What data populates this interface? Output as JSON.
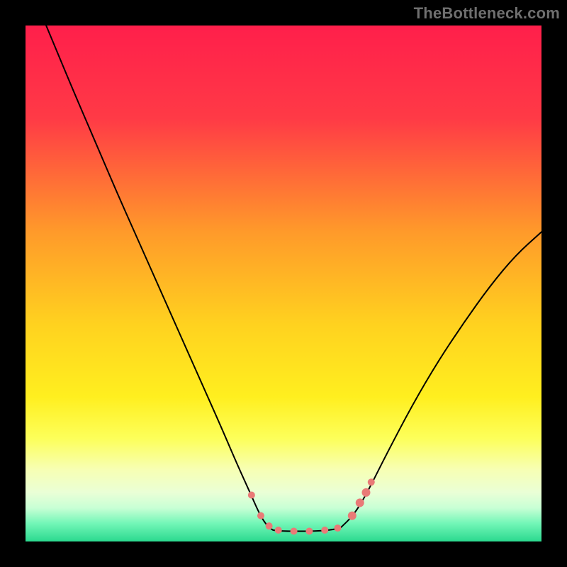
{
  "watermark": "TheBottleneck.com",
  "chart_data": {
    "type": "line",
    "title": "",
    "xlabel": "",
    "ylabel": "",
    "xlim": [
      0,
      100
    ],
    "ylim": [
      0,
      100
    ],
    "gradient_stops": [
      {
        "offset": 0.0,
        "color": "#ff1f4b"
      },
      {
        "offset": 0.18,
        "color": "#ff3a46"
      },
      {
        "offset": 0.4,
        "color": "#ff9a2a"
      },
      {
        "offset": 0.58,
        "color": "#ffd21f"
      },
      {
        "offset": 0.72,
        "color": "#ffef1f"
      },
      {
        "offset": 0.8,
        "color": "#fdff5a"
      },
      {
        "offset": 0.86,
        "color": "#f7ffb3"
      },
      {
        "offset": 0.905,
        "color": "#eaffd6"
      },
      {
        "offset": 0.935,
        "color": "#c8ffd5"
      },
      {
        "offset": 0.965,
        "color": "#72f6b7"
      },
      {
        "offset": 1.0,
        "color": "#2bd98f"
      }
    ],
    "series": [
      {
        "name": "left-branch",
        "x": [
          4.0,
          6.5,
          9.0,
          12.0,
          15.0,
          18.0,
          22.0,
          26.0,
          30.0,
          34.0,
          38.0,
          41.0,
          43.5,
          45.5,
          47.0,
          48.0
        ],
        "y": [
          100.0,
          94.0,
          88.0,
          81.0,
          74.0,
          67.0,
          58.0,
          49.0,
          40.0,
          31.0,
          22.0,
          15.0,
          9.5,
          5.0,
          2.8,
          2.2
        ]
      },
      {
        "name": "floor",
        "x": [
          48.0,
          50.0,
          53.0,
          56.0,
          59.0,
          61.0
        ],
        "y": [
          2.2,
          2.0,
          2.0,
          2.0,
          2.2,
          2.6
        ]
      },
      {
        "name": "right-branch",
        "x": [
          61.0,
          63.5,
          66.0,
          70.0,
          75.0,
          80.0,
          85.0,
          90.0,
          95.0,
          100.0
        ],
        "y": [
          2.6,
          5.0,
          9.0,
          17.0,
          26.5,
          35.0,
          42.5,
          49.5,
          55.5,
          60.0
        ]
      }
    ],
    "markers": [
      {
        "x": 43.8,
        "y": 9.0,
        "r": 5
      },
      {
        "x": 45.6,
        "y": 5.0,
        "r": 5
      },
      {
        "x": 47.2,
        "y": 3.0,
        "r": 5
      },
      {
        "x": 49.0,
        "y": 2.2,
        "r": 5
      },
      {
        "x": 52.0,
        "y": 2.0,
        "r": 5
      },
      {
        "x": 55.0,
        "y": 2.0,
        "r": 5
      },
      {
        "x": 58.0,
        "y": 2.2,
        "r": 5
      },
      {
        "x": 60.5,
        "y": 2.6,
        "r": 5
      },
      {
        "x": 63.3,
        "y": 5.0,
        "r": 6
      },
      {
        "x": 64.8,
        "y": 7.5,
        "r": 6
      },
      {
        "x": 66.0,
        "y": 9.5,
        "r": 6
      },
      {
        "x": 67.0,
        "y": 11.5,
        "r": 5
      }
    ],
    "marker_color": "#e97a77",
    "curve_color": "#000000",
    "curve_width": 2.0
  }
}
